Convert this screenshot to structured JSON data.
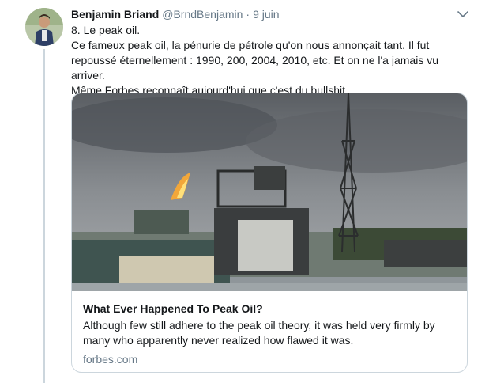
{
  "tweet": {
    "author_name": "Benjamin Briand",
    "author_handle": "@BrndBenjamin",
    "separator": "·",
    "date": "9 juin",
    "lines": [
      "8. Le peak oil.",
      "Ce fameux peak oil, la pénurie de pétrole qu'on nous annonçait tant. Il fut",
      "repoussé éternellement : 1990, 200, 2004, 2010, etc. Et on ne l'a jamais vu arriver.",
      "Même Forbes reconnaît aujourd'hui que c'est du bullshit."
    ]
  },
  "card": {
    "title": "What Ever Happened To Peak Oil?",
    "description_lines": [
      "Although few still adhere to the peak oil theory, it was held very firmly by",
      "many who apparently never realized how flawed it was."
    ],
    "domain": "forbes.com"
  },
  "icons": {
    "caret": "chevron-down-icon",
    "avatar": "avatar"
  },
  "colors": {
    "text": "#14171a",
    "secondary": "#657786",
    "border": "#ccd6dd"
  }
}
